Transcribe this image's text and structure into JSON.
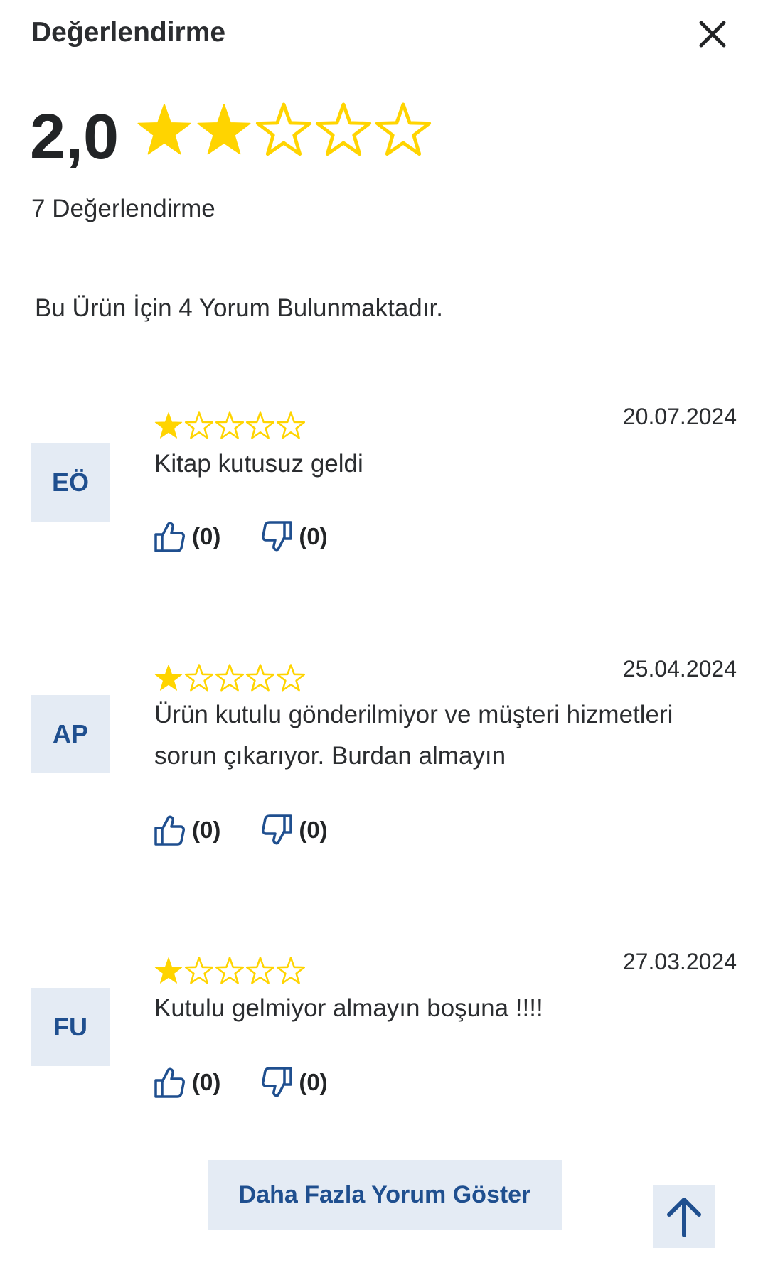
{
  "header": {
    "title": "Değerlendirme",
    "close_icon": "close-icon"
  },
  "summary": {
    "score": "2,0",
    "rating": 2,
    "max_rating": 5,
    "count_label": "7 Değerlendirme"
  },
  "reviews_info": "Bu Ürün İçin 4 Yorum Bulunmaktadır.",
  "reviews": [
    {
      "initials": "EÖ",
      "rating": 1,
      "date": "20.07.2024",
      "text": "Kitap kutusuz geldi",
      "likes": "(0)",
      "dislikes": "(0)"
    },
    {
      "initials": "AP",
      "rating": 1,
      "date": "25.04.2024",
      "text": "Ürün kutulu gönderilmiyor ve müşteri hizmetleri sorun çıkarıyor. Burdan almayın",
      "likes": "(0)",
      "dislikes": "(0)"
    },
    {
      "initials": "FU",
      "rating": 1,
      "date": "27.03.2024",
      "text": "Kutulu gelmiyor almayın boşuna !!!!",
      "likes": "(0)",
      "dislikes": "(0)"
    }
  ],
  "more_button": "Daha Fazla Yorum Göster",
  "scroll_top_icon": "arrow-up-icon",
  "colors": {
    "star": "#FFD400",
    "accent": "#1F4F8F",
    "chip_bg": "#E4EBF4"
  }
}
